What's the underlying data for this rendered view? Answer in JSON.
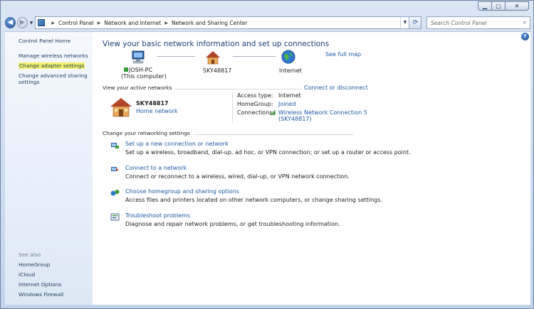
{
  "window": {
    "minimize_glyph": "▁",
    "maximize_glyph": "▢",
    "close_glyph": "✕"
  },
  "nav": {
    "back_glyph": "◀",
    "forward_glyph": "▶",
    "breadcrumb": [
      "Control Panel",
      "Network and Internet",
      "Network and Sharing Center"
    ],
    "search_placeholder": "Search Control Panel"
  },
  "side": {
    "home": "Control Panel Home",
    "links": [
      "Manage wireless networks",
      "Change adapter settings",
      "Change advanced sharing",
      "settings"
    ],
    "see_also_label": "See also",
    "see_also": [
      "HomeGroup",
      "iCloud",
      "Internet Options",
      "Windows Firewall"
    ]
  },
  "main": {
    "title": "View your basic network information and set up connections",
    "see_full_map": "See full map",
    "map": {
      "computer_name": "JOSH-PC",
      "computer_sub": "(This computer)",
      "network": "SKY48817",
      "internet": "Internet"
    },
    "active": {
      "title": "View your active networks",
      "connect_link": "Connect or disconnect",
      "network_name": "SKY48817",
      "network_type": "Home network",
      "access_type_label": "Access type:",
      "access_type_value": "Internet",
      "homegroup_label": "HomeGroup:",
      "homegroup_value": "Joined",
      "connections_label": "Connections:",
      "connection_line1": "Wireless Network Connection 5",
      "connection_line2": "(SKY48817)"
    },
    "change": {
      "title": "Change your networking settings",
      "tasks": [
        {
          "link": "Set up a new connection or network",
          "desc": "Set up a wireless, broadband, dial-up, ad hoc, or VPN connection; or set up a router or access point."
        },
        {
          "link": "Connect to a network",
          "desc": "Connect or reconnect to a wireless, wired, dial-up, or VPN network connection."
        },
        {
          "link": "Choose homegroup and sharing options",
          "desc": "Access files and printers located on other network computers, or change sharing settings."
        },
        {
          "link": "Troubleshoot problems",
          "desc": "Diagnose and repair network problems, or get troubleshooting information."
        }
      ]
    }
  },
  "colors": {
    "link": "#1a5aa8",
    "heading": "#1f3f78",
    "highlight": "#f4f26a"
  }
}
